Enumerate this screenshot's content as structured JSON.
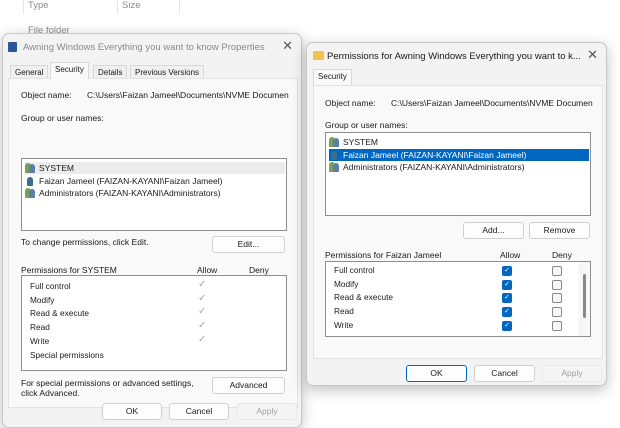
{
  "explorer": {
    "col_type": "Type",
    "col_size": "Size",
    "row_type": "File folder"
  },
  "properties": {
    "title": "Awning Windows Everything you want to know Properties",
    "tabs": [
      "General",
      "Security",
      "Details",
      "Previous Versions"
    ],
    "object_label": "Object name:",
    "object_value": "C:\\Users\\Faizan Jameel\\Documents\\NVME Documen",
    "group_label": "Group or user names:",
    "users": [
      "SYSTEM",
      "Faizan Jameel (FAIZAN-KAYANI\\Faizan Jameel)",
      "Administrators (FAIZAN-KAYANI\\Administrators)"
    ],
    "change_text": "To change permissions, click Edit.",
    "edit": "Edit...",
    "perm_header": "Permissions for SYSTEM",
    "allow": "Allow",
    "deny": "Deny",
    "perms": [
      {
        "name": "Full control",
        "allow": true
      },
      {
        "name": "Modify",
        "allow": true
      },
      {
        "name": "Read & execute",
        "allow": true
      },
      {
        "name": "Read",
        "allow": true
      },
      {
        "name": "Write",
        "allow": true
      },
      {
        "name": "Special permissions",
        "allow": false
      }
    ],
    "adv_text1": "For special permissions or advanced settings,",
    "adv_text2": "click Advanced.",
    "advanced": "Advanced",
    "ok": "OK",
    "cancel": "Cancel",
    "apply": "Apply"
  },
  "permissions": {
    "title": "Permissions for Awning Windows Everything you want to k...",
    "tab": "Security",
    "object_label": "Object name:",
    "object_value": "C:\\Users\\Faizan Jameel\\Documents\\NVME Documen",
    "group_label": "Group or user names:",
    "users": [
      "SYSTEM",
      "Faizan Jameel (FAIZAN-KAYANI\\Faizan Jameel)",
      "Administrators (FAIZAN-KAYANI\\Administrators)"
    ],
    "selected_user": 1,
    "add": "Add...",
    "remove": "Remove",
    "perm_header": "Permissions for Faizan Jameel",
    "allow": "Allow",
    "deny": "Deny",
    "perms": [
      {
        "name": "Full control",
        "allow": true,
        "deny": false
      },
      {
        "name": "Modify",
        "allow": true,
        "deny": false
      },
      {
        "name": "Read & execute",
        "allow": true,
        "deny": false
      },
      {
        "name": "Read",
        "allow": true,
        "deny": false
      },
      {
        "name": "Write",
        "allow": true,
        "deny": false
      }
    ],
    "ok": "OK",
    "cancel": "Cancel",
    "apply": "Apply",
    "accent": "#0067c0"
  }
}
